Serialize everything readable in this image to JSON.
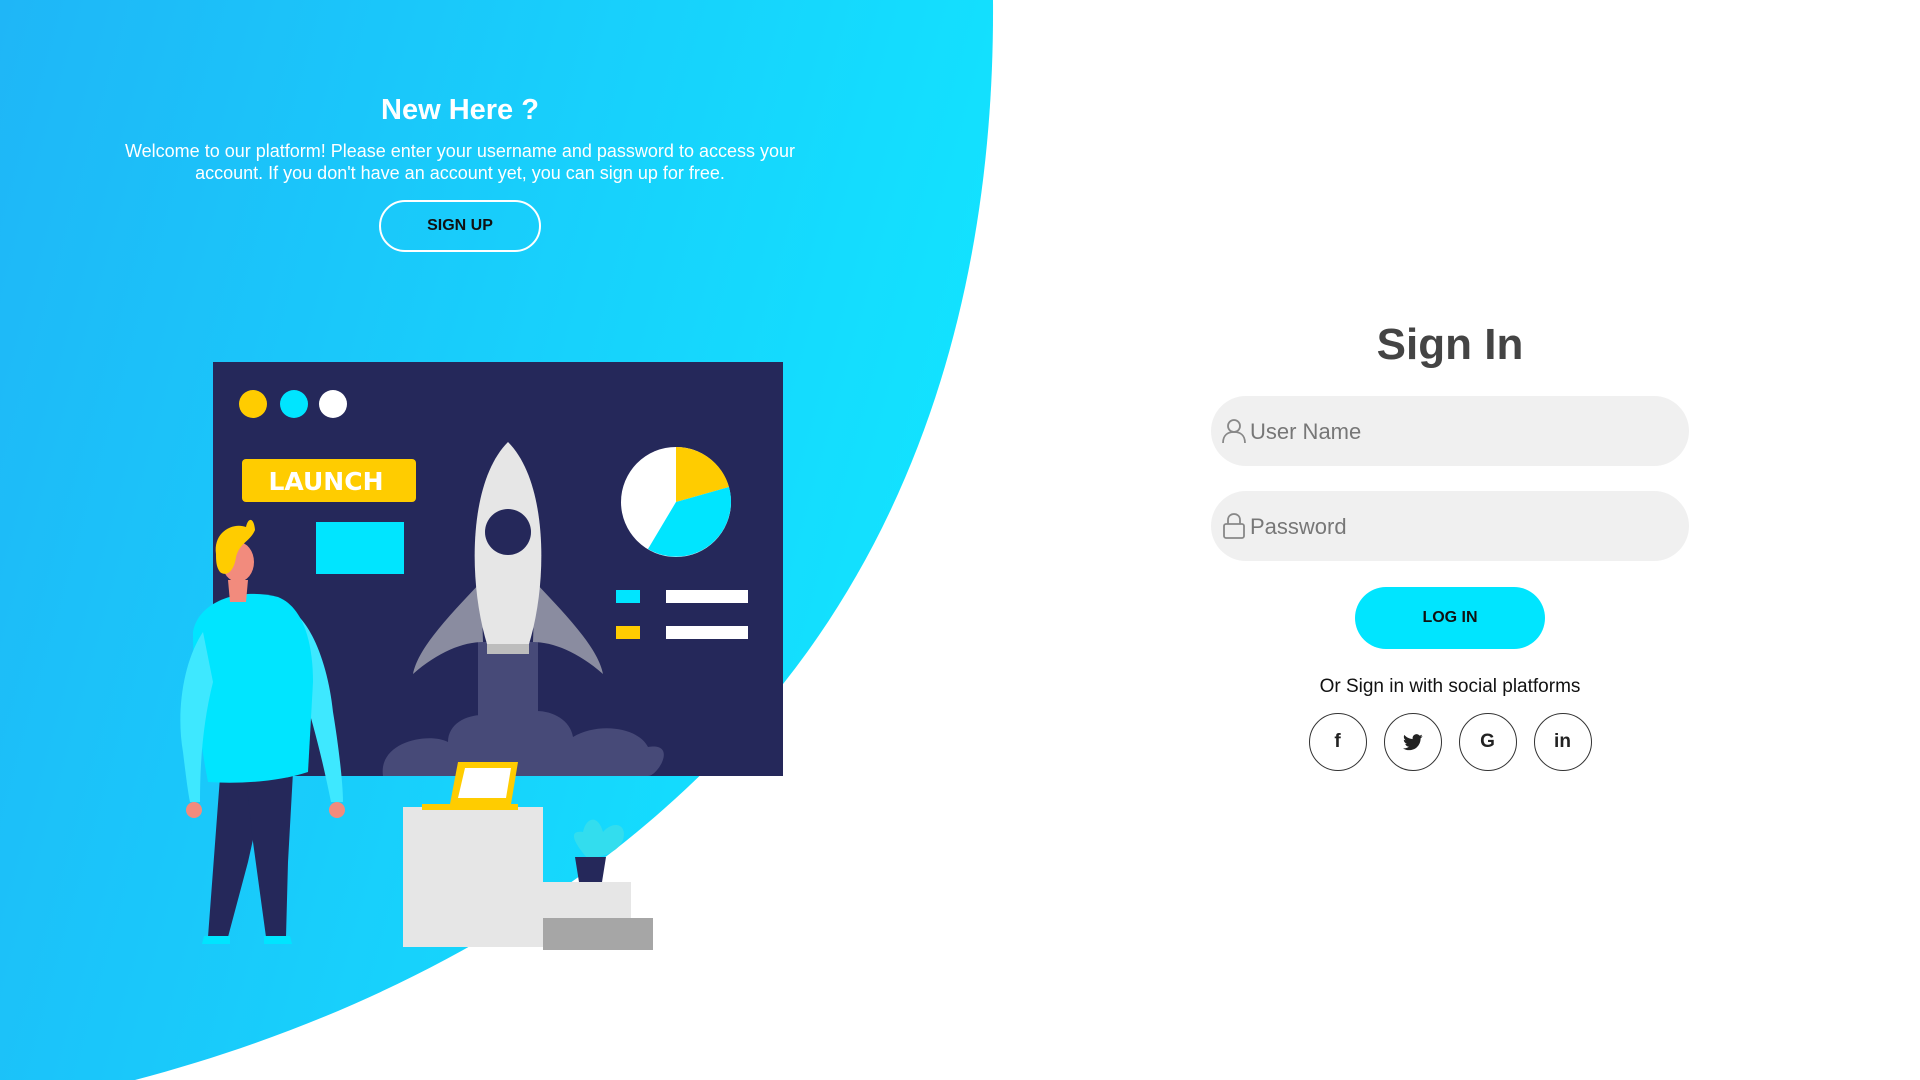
{
  "left": {
    "title": "New Here ?",
    "description": "Welcome to our platform! Please enter your username and password to access your account. If you don't have an account yet, you can sign up for free.",
    "signup_label": "SIGN UP"
  },
  "illustration": {
    "launch_label": "LAUNCH",
    "icon": "rocket-launch-illustration",
    "colors": {
      "board": "#25285a",
      "yellow": "#ffcc00",
      "cyan": "#00e5ff",
      "rocket": "#e6e6e6"
    }
  },
  "form": {
    "title": "Sign In",
    "username_placeholder": "User Name",
    "password_placeholder": "Password",
    "login_label": "LOG IN",
    "social_text": "Or Sign in with social platforms",
    "social": [
      {
        "icon": "facebook-icon",
        "glyph": "f"
      },
      {
        "icon": "twitter-icon",
        "glyph": ""
      },
      {
        "icon": "google-icon",
        "glyph": "G"
      },
      {
        "icon": "linkedin-icon",
        "glyph": "in"
      }
    ]
  },
  "colors": {
    "accent": "#00e5ff",
    "gradient_start": "#1fb6f7",
    "gradient_end": "#12e3ff",
    "title_text": "#444444",
    "field_bg": "#f0f0f0"
  }
}
